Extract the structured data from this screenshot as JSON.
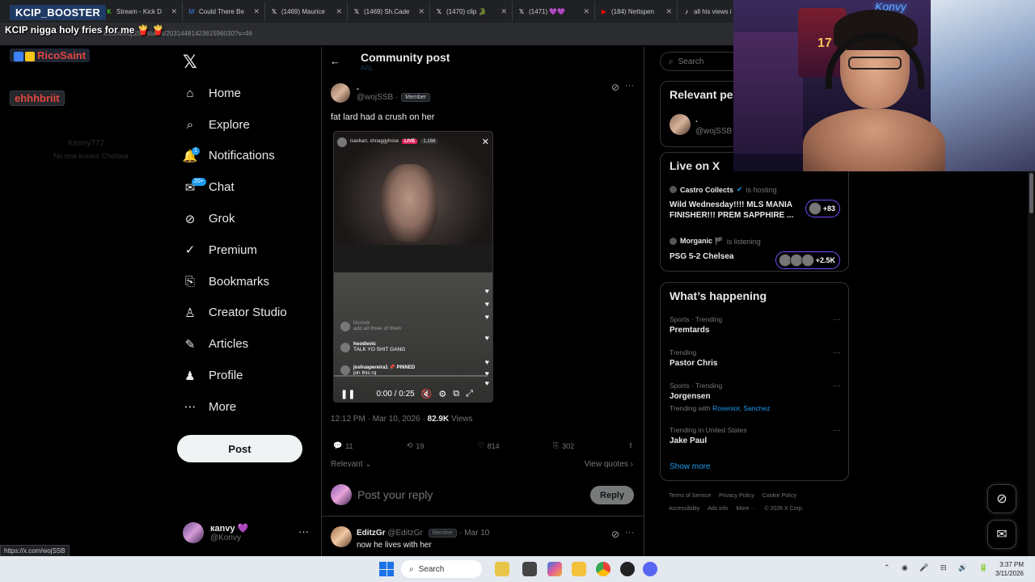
{
  "browser": {
    "tabs": [
      {
        "title": "Stream - Kick D",
        "icon": "kick-icon",
        "color": "#53fc18"
      },
      {
        "title": "Could There Be",
        "icon": "m-icon",
        "color": "#4285f4"
      },
      {
        "title": "(1469) Maurice",
        "icon": "x-icon",
        "color": "#ffffff"
      },
      {
        "title": "(1469) Sh.Cade",
        "icon": "x-icon",
        "color": "#ffffff"
      },
      {
        "title": "(1470) clip 🐊",
        "icon": "x-icon",
        "color": "#ffffff"
      },
      {
        "title": "(1471) 💜💜",
        "icon": "x-icon",
        "color": "#ffffff"
      },
      {
        "title": "(184) Nettspen",
        "icon": "youtube-icon",
        "color": "#ff0000"
      },
      {
        "title": "all his views i",
        "icon": "tiktok-icon",
        "color": "#ffffff"
      }
    ],
    "url": "x.com/wojSSB/status/2031448142361596030?s=46",
    "status_link": "https://x.com/wojSSB"
  },
  "stream_overlay": {
    "booster_label": "KCIP_BOOSTER",
    "chat_message": "KCIP nigga holy fries for me",
    "chat_emotes": "🍟 🍟",
    "user1": "RicoSaint",
    "user2": "ehhhbriit",
    "faint_user": "Kenny777",
    "faint_text": "No one knows Chelsea"
  },
  "sidebar": {
    "logo": "𝕏",
    "items": [
      {
        "label": "Home",
        "icon": "home-icon",
        "glyph": "⌂"
      },
      {
        "label": "Explore",
        "icon": "search-icon",
        "glyph": "⌕"
      },
      {
        "label": "Notifications",
        "icon": "bell-icon",
        "glyph": "🔔",
        "badge": "1"
      },
      {
        "label": "Chat",
        "icon": "chat-icon",
        "glyph": "✉",
        "badge": "20+"
      },
      {
        "label": "Grok",
        "icon": "grok-icon",
        "glyph": "⊘"
      },
      {
        "label": "Premium",
        "icon": "premium-icon",
        "glyph": "✓"
      },
      {
        "label": "Bookmarks",
        "icon": "bookmark-icon",
        "glyph": "⎘"
      },
      {
        "label": "Creator Studio",
        "icon": "creator-studio-icon",
        "glyph": "♙"
      },
      {
        "label": "Articles",
        "icon": "articles-icon",
        "glyph": "✎"
      },
      {
        "label": "Profile",
        "icon": "profile-icon",
        "glyph": "♟"
      },
      {
        "label": "More",
        "icon": "more-icon",
        "glyph": "⋯"
      }
    ],
    "post_button": "Post",
    "account": {
      "name": "кanvy 💜",
      "handle": "@Konvy"
    }
  },
  "main": {
    "header_title": "Community post",
    "header_sub": "ARL",
    "post": {
      "author_name": ".",
      "handle": "@wojSSB",
      "member_badge": "Member",
      "text": "fat lard had a crush on her",
      "timestamp": "12:12 PM · Mar 10, 2026 ·",
      "views_count": "82.9K",
      "views_label": "Views",
      "actions": {
        "replies": "11",
        "reposts": "19",
        "likes": "814",
        "bookmarks": "302"
      },
      "sort_label": "Relevant",
      "view_quotes": "View quotes"
    },
    "video": {
      "header_users": "isavbarr, shnaggyhose",
      "live_label": "LIVE",
      "viewers": "1,168",
      "comments": [
        {
          "user": "lizcrook",
          "text": "add all three of them",
          "faint": true
        },
        {
          "user": "hoodievic",
          "text": "TALK YO SHIT GANG",
          "faint": false
        },
        {
          "user": "joshuapereira1 📌 PINNED",
          "text": "pin this rq",
          "faint": false
        }
      ],
      "time": "0:00 / 0:25",
      "progress": 0.0
    },
    "reply_placeholder": "Post your reply",
    "reply_button": "Reply",
    "reply2": {
      "name": "EditzGr",
      "handle": "@EditzGr",
      "badge": "Member",
      "date": "· Mar 10",
      "text": "now he lives with her"
    }
  },
  "right": {
    "search_placeholder": "Search",
    "relevant_title": "Relevant people",
    "relevant_person": {
      "name": ".",
      "handle": "@wojSSB"
    },
    "live_title": "Live on X",
    "live": [
      {
        "host": "Castro Collects",
        "role": "is hosting",
        "title": "Wild Wednesday!!!! MLS MANIA FINISHER!!! PREM SAPPHIRE ...",
        "count": "+83"
      },
      {
        "host": "Morganic 🏴",
        "role": "is listening",
        "title": "PSG 5-2 Chelsea",
        "count": "+2.5K"
      }
    ],
    "happening_title": "What’s happening",
    "trends": [
      {
        "category": "Sports · Trending",
        "name": "Premtards"
      },
      {
        "category": "Trending",
        "name": "Pastor Chris"
      },
      {
        "category": "Sports · Trending",
        "name": "Jorgensen",
        "with_prefix": "Trending with",
        "with": "Rosenior, Sanchez"
      },
      {
        "category": "Trending in United States",
        "name": "Jake Paul"
      }
    ],
    "show_more": "Show more",
    "footer_line1": [
      "Terms of Service",
      "Privacy Policy",
      "Cookie Policy"
    ],
    "footer_line2": [
      "Accessibility",
      "Ads info",
      "More ···",
      "© 2026 X Corp."
    ]
  },
  "webcam": {
    "neon_sign": "Konvy",
    "jersey_number": "17"
  },
  "taskbar": {
    "search_label": "Search",
    "time": "3:37 PM",
    "date": "3/11/2026"
  }
}
